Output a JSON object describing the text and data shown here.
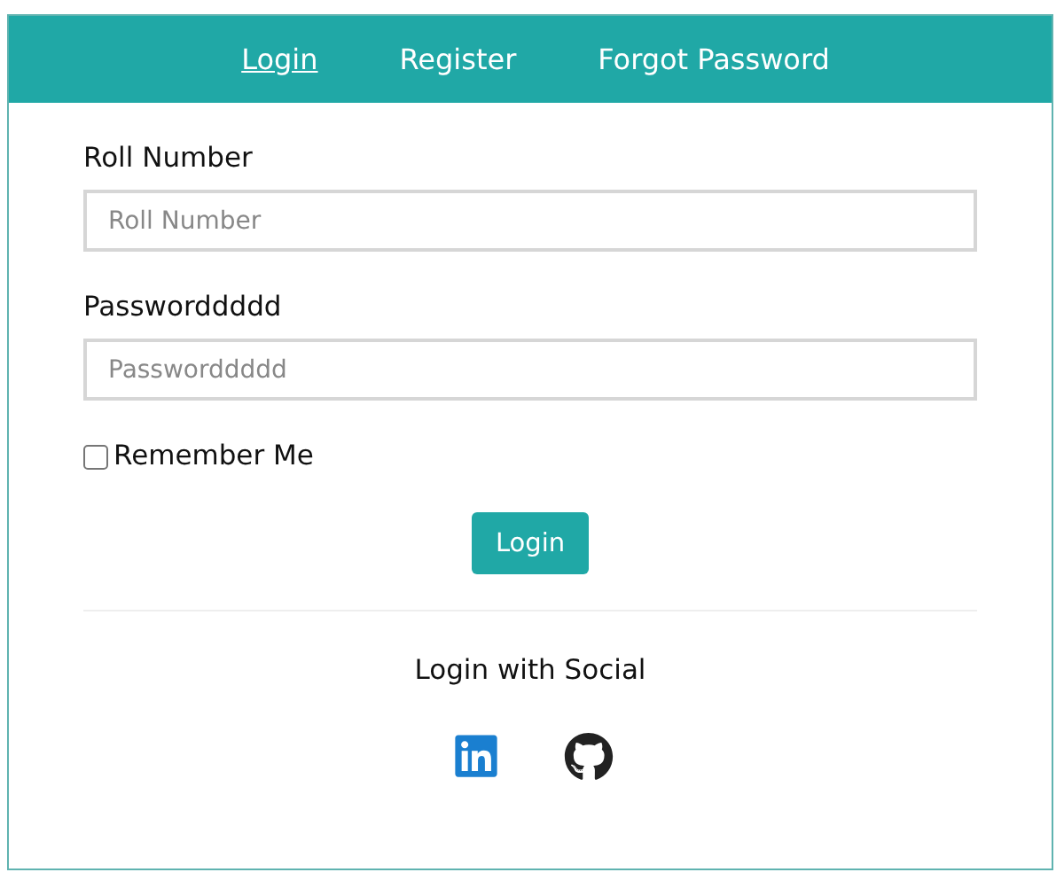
{
  "tabs": [
    {
      "label": "Login",
      "selected": true
    },
    {
      "label": "Register",
      "selected": false
    },
    {
      "label": "Forgot Password",
      "selected": false
    }
  ],
  "fields": [
    {
      "label": "Roll Number",
      "placeholder": "Roll Number"
    },
    {
      "label": "Passworddddd",
      "placeholder": "Passworddddd"
    }
  ],
  "remember": {
    "label": "Remember Me",
    "checked": false
  },
  "submit": "Login",
  "social": {
    "heading": "Login with Social",
    "links": [
      {
        "kind": "linkedin"
      },
      {
        "kind": "github"
      }
    ]
  }
}
